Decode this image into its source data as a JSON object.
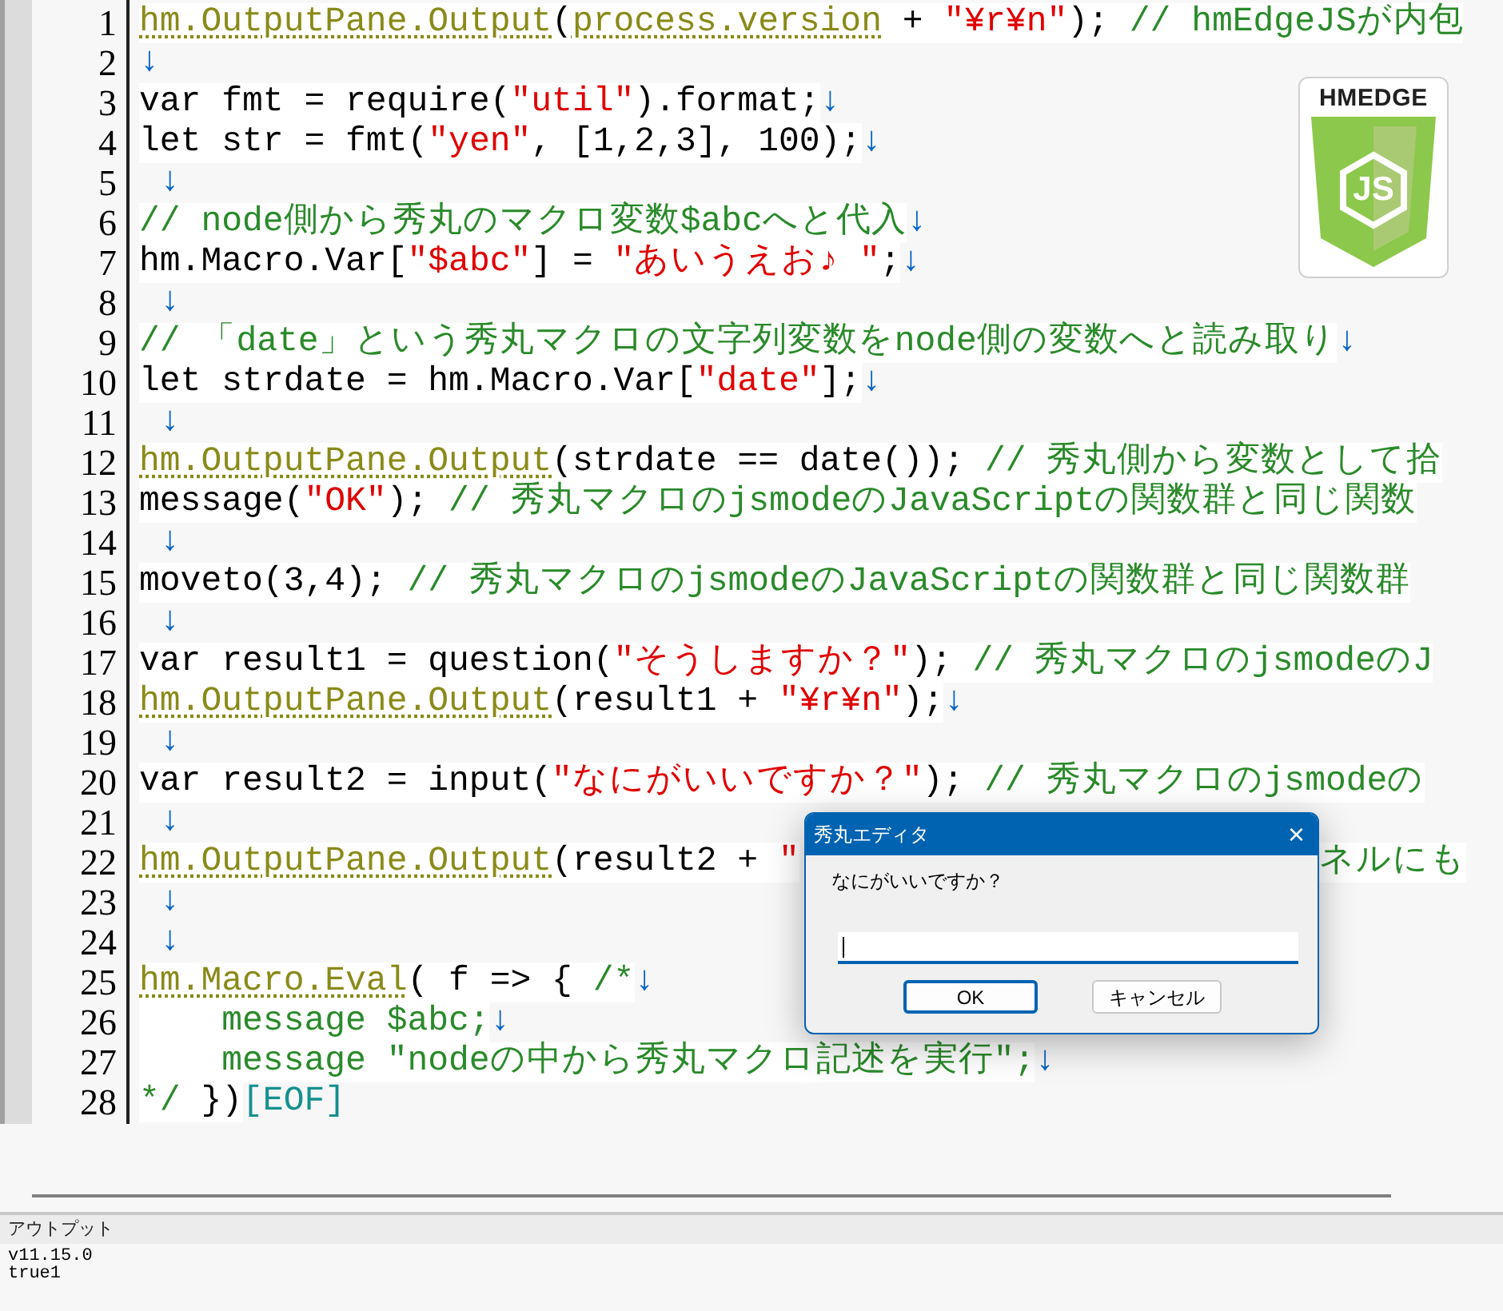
{
  "editor": {
    "lines": [
      {
        "number": "1",
        "tokens": [
          {
            "kind": "method",
            "text": "hm.OutputPane.Output"
          },
          {
            "kind": "plain",
            "text": "("
          },
          {
            "kind": "method",
            "text": "process.version"
          },
          {
            "kind": "plain",
            "text": " + "
          },
          {
            "kind": "string",
            "text": "\"¥r¥n\""
          },
          {
            "kind": "plain",
            "text": "); "
          },
          {
            "kind": "comment",
            "text": "// hmEdgeJSが内包"
          }
        ]
      },
      {
        "number": "2",
        "tokens": [
          {
            "kind": "newline",
            "text": "↓"
          }
        ]
      },
      {
        "number": "3",
        "tokens": [
          {
            "kind": "plain",
            "text": "var fmt = require("
          },
          {
            "kind": "string",
            "text": "\"util\""
          },
          {
            "kind": "plain",
            "text": ").format;"
          },
          {
            "kind": "newline",
            "text": "↓"
          }
        ]
      },
      {
        "number": "4",
        "tokens": [
          {
            "kind": "plain",
            "text": "let str = fmt("
          },
          {
            "kind": "string",
            "text": "\"yen\""
          },
          {
            "kind": "plain",
            "text": ", [1,2,3], 100);"
          },
          {
            "kind": "newline",
            "text": "↓"
          }
        ]
      },
      {
        "number": "5",
        "tokens": [
          {
            "kind": "newline",
            "text": " ↓"
          }
        ]
      },
      {
        "number": "6",
        "tokens": [
          {
            "kind": "comment",
            "text": "// node側から秀丸のマクロ変数$abcへと代入"
          },
          {
            "kind": "newline",
            "text": "↓"
          }
        ]
      },
      {
        "number": "7",
        "tokens": [
          {
            "kind": "plain",
            "text": "hm.Macro.Var["
          },
          {
            "kind": "string",
            "text": "\"$abc\""
          },
          {
            "kind": "plain",
            "text": "] = "
          },
          {
            "kind": "string",
            "text": "\"あいうえお♪ \""
          },
          {
            "kind": "plain",
            "text": ";"
          },
          {
            "kind": "newline",
            "text": "↓"
          }
        ]
      },
      {
        "number": "8",
        "tokens": [
          {
            "kind": "newline",
            "text": " ↓"
          }
        ]
      },
      {
        "number": "9",
        "tokens": [
          {
            "kind": "comment",
            "text": "// 「date」という秀丸マクロの文字列変数をnode側の変数へと読み取り"
          },
          {
            "kind": "newline",
            "text": "↓"
          }
        ]
      },
      {
        "number": "10",
        "tokens": [
          {
            "kind": "plain",
            "text": "let strdate = hm.Macro.Var["
          },
          {
            "kind": "string",
            "text": "\"date\""
          },
          {
            "kind": "plain",
            "text": "];"
          },
          {
            "kind": "newline",
            "text": "↓"
          }
        ]
      },
      {
        "number": "11",
        "tokens": [
          {
            "kind": "newline",
            "text": " ↓"
          }
        ]
      },
      {
        "number": "12",
        "tokens": [
          {
            "kind": "method",
            "text": "hm.OutputPane.Output"
          },
          {
            "kind": "plain",
            "text": "(strdate == date()); "
          },
          {
            "kind": "comment",
            "text": "// 秀丸側から変数として拾"
          }
        ]
      },
      {
        "number": "13",
        "tokens": [
          {
            "kind": "plain",
            "text": "message("
          },
          {
            "kind": "string",
            "text": "\"OK\""
          },
          {
            "kind": "plain",
            "text": "); "
          },
          {
            "kind": "comment",
            "text": "// 秀丸マクロのjsmodeのJavaScriptの関数群と同じ関数"
          }
        ]
      },
      {
        "number": "14",
        "tokens": [
          {
            "kind": "newline",
            "text": " ↓"
          }
        ]
      },
      {
        "number": "15",
        "tokens": [
          {
            "kind": "plain",
            "text": "moveto(3,4); "
          },
          {
            "kind": "comment",
            "text": "// 秀丸マクロのjsmodeのJavaScriptの関数群と同じ関数群"
          }
        ]
      },
      {
        "number": "16",
        "tokens": [
          {
            "kind": "newline",
            "text": " ↓"
          }
        ]
      },
      {
        "number": "17",
        "tokens": [
          {
            "kind": "plain",
            "text": "var result1 = question("
          },
          {
            "kind": "string",
            "text": "\"そうしますか？\""
          },
          {
            "kind": "plain",
            "text": "); "
          },
          {
            "kind": "comment",
            "text": "// 秀丸マクロのjsmodeのJ"
          }
        ]
      },
      {
        "number": "18",
        "tokens": [
          {
            "kind": "method",
            "text": "hm.OutputPane.Output"
          },
          {
            "kind": "plain",
            "text": "(result1 + "
          },
          {
            "kind": "string",
            "text": "\"¥r¥n\""
          },
          {
            "kind": "plain",
            "text": ");"
          },
          {
            "kind": "newline",
            "text": "↓"
          }
        ]
      },
      {
        "number": "19",
        "tokens": [
          {
            "kind": "newline",
            "text": " ↓"
          }
        ]
      },
      {
        "number": "20",
        "tokens": [
          {
            "kind": "plain",
            "text": "var result2 = input("
          },
          {
            "kind": "string",
            "text": "\"なにがいいですか？\""
          },
          {
            "kind": "plain",
            "text": "); "
          },
          {
            "kind": "comment",
            "text": "// 秀丸マクロのjsmodeの"
          }
        ]
      },
      {
        "number": "21",
        "tokens": [
          {
            "kind": "newline",
            "text": " ↓"
          }
        ]
      },
      {
        "number": "22",
        "tokens": [
          {
            "kind": "method",
            "text": "hm.OutputPane.Output"
          },
          {
            "kind": "plain",
            "text": "(result2 + "
          },
          {
            "kind": "string",
            "text": "\""
          },
          {
            "kind": "comment",
            "text": "ネルにも",
            "after_overlay": true
          }
        ]
      },
      {
        "number": "23",
        "tokens": [
          {
            "kind": "newline",
            "text": " ↓"
          }
        ]
      },
      {
        "number": "24",
        "tokens": [
          {
            "kind": "newline",
            "text": " ↓"
          }
        ]
      },
      {
        "number": "25",
        "tokens": [
          {
            "kind": "method",
            "text": "hm.Macro.Eval"
          },
          {
            "kind": "plain",
            "text": "( f => { "
          },
          {
            "kind": "comment",
            "text": "/*"
          },
          {
            "kind": "newline",
            "text": "↓"
          }
        ]
      },
      {
        "number": "26",
        "tokens": [
          {
            "kind": "comment",
            "text": "    message $abc;"
          },
          {
            "kind": "newline",
            "text": "↓"
          }
        ]
      },
      {
        "number": "27",
        "tokens": [
          {
            "kind": "comment",
            "text": "    message \"nodeの中から秀丸マクロ記述を実行\";"
          },
          {
            "kind": "newline",
            "text": "↓"
          }
        ]
      },
      {
        "number": "28",
        "tokens": [
          {
            "kind": "comment",
            "text": "*/"
          },
          {
            "kind": "plain",
            "text": " })"
          },
          {
            "kind": "eof",
            "text": "[EOF]"
          }
        ]
      }
    ]
  },
  "logo": {
    "title": "HMEDGE",
    "badge": "JS"
  },
  "dialog": {
    "title": "秀丸エディタ",
    "close": "×",
    "prompt": "なにがいいですか？",
    "buttons": [
      {
        "label": "OK",
        "default": true
      },
      {
        "label": "キャンセル",
        "default": false
      }
    ]
  },
  "output_pane": {
    "title": "アウトプット",
    "lines": [
      "v11.15.0",
      "true1"
    ]
  }
}
